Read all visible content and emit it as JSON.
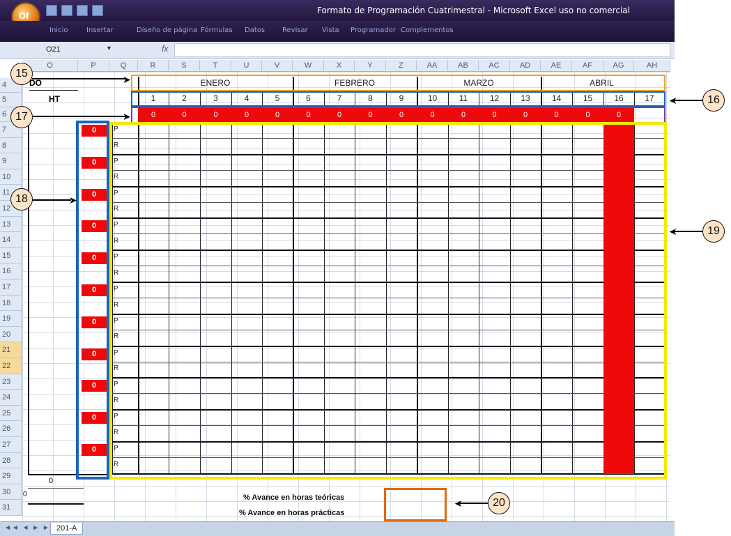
{
  "window": {
    "title": "Formato de Programación Cuatrimestral - Microsoft Excel uso no comercial",
    "office_button_label": "Of"
  },
  "ribbon_tabs": [
    "Inicio",
    "Insertar",
    "Diseño de página",
    "Fórmulas",
    "Datos",
    "Revisar",
    "Vista",
    "Programador",
    "Complementos"
  ],
  "formula_bar": {
    "name_box": "O21",
    "fx": "fx",
    "formula": ""
  },
  "columns": [
    "O",
    "P",
    "Q",
    "R",
    "S",
    "T",
    "U",
    "V",
    "W",
    "X",
    "Y",
    "Z",
    "AA",
    "AB",
    "AC",
    "AD",
    "AE",
    "AF",
    "AG",
    "AH"
  ],
  "rows": [
    "4",
    "5",
    "6",
    "7",
    "8",
    "9",
    "10",
    "11",
    "12",
    "13",
    "14",
    "15",
    "16",
    "17",
    "18",
    "19",
    "20",
    "21",
    "22",
    "23",
    "24",
    "25",
    "26",
    "27",
    "28",
    "29",
    "30",
    "31"
  ],
  "header_cells": {
    "do": "DO",
    "ht": "HT"
  },
  "months": [
    "ENERO",
    "FEBRERO",
    "MARZO",
    "ABRIL"
  ],
  "days": [
    "1",
    "2",
    "3",
    "4",
    "5",
    "6",
    "7",
    "8",
    "9",
    "10",
    "11",
    "12",
    "13",
    "14",
    "15",
    "16",
    "17"
  ],
  "red_row_values": [
    "0",
    "0",
    "0",
    "0",
    "0",
    "0",
    "0",
    "0",
    "0",
    "0",
    "0",
    "0",
    "0",
    "0",
    "0",
    "0"
  ],
  "left_zero": "0",
  "p_label": "P",
  "r_label": "R",
  "row29_value": "0",
  "row30_value": "0",
  "percent_labels": {
    "theory": "% Avance en horas teóricas",
    "practice": "% Avance en horas prácticas"
  },
  "sheet_tab": "201-A",
  "callouts": [
    "15",
    "16",
    "17",
    "18",
    "19",
    "20"
  ],
  "colors": {
    "red": "#ee0a0a",
    "orange_box": "#f0a020",
    "blue_box": "#1a64c0",
    "purple_box": "#7a3aa8",
    "yellow_box": "#f5e800",
    "dark_orange": "#e06a10"
  }
}
